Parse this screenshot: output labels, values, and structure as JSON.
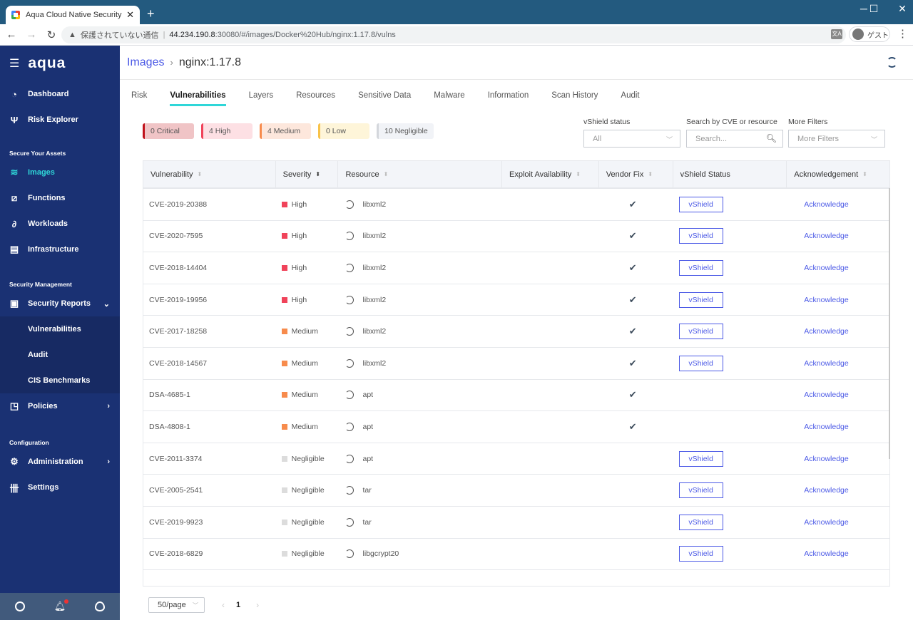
{
  "browser": {
    "tab_title": "Aqua Cloud Native Security Platfo",
    "new_tab": "+",
    "insecure_label": "保護されていない通信",
    "url_host": "44.234.190.8",
    "url_path": ":30080/#/images/Docker%20Hub/nginx:1.17.8/vulns",
    "profile_label": "ゲスト",
    "window_controls": {
      "minimize": "─",
      "maximize": "☐",
      "close": "✕"
    }
  },
  "sidebar": {
    "logo": "aqua",
    "top_items": [
      {
        "label": "Dashboard",
        "icon": "gauge-icon"
      },
      {
        "label": "Risk Explorer",
        "icon": "risk-explorer-icon"
      }
    ],
    "section_assets": "Secure Your Assets",
    "asset_items": [
      {
        "label": "Images",
        "icon": "layers-icon",
        "active": true
      },
      {
        "label": "Functions",
        "icon": "functions-icon"
      },
      {
        "label": "Workloads",
        "icon": "workloads-icon"
      },
      {
        "label": "Infrastructure",
        "icon": "server-icon"
      }
    ],
    "section_management": "Security Management",
    "security_reports": {
      "label": "Security Reports",
      "expanded": true
    },
    "report_subitems": [
      "Vulnerabilities",
      "Audit",
      "CIS Benchmarks"
    ],
    "policies": "Policies",
    "section_config": "Configuration",
    "administration": "Administration",
    "settings": "Settings"
  },
  "header": {
    "breadcrumb_parent": "Images",
    "breadcrumb_separator": "›",
    "breadcrumb_current": "nginx:1.17.8"
  },
  "tabs": [
    {
      "label": "Risk"
    },
    {
      "label": "Vulnerabilities",
      "active": true
    },
    {
      "label": "Layers"
    },
    {
      "label": "Resources"
    },
    {
      "label": "Sensitive Data"
    },
    {
      "label": "Malware"
    },
    {
      "label": "Information"
    },
    {
      "label": "Scan History"
    },
    {
      "label": "Audit"
    }
  ],
  "severity_summary": [
    {
      "label": "0 Critical",
      "bg": "#f0c4c6",
      "bar": "#c0111a"
    },
    {
      "label": "4 High",
      "bg": "#fde0e4",
      "bar": "#f0435a"
    },
    {
      "label": "4 Medium",
      "bg": "#fde7dc",
      "bar": "#f78b4c"
    },
    {
      "label": "0 Low",
      "bg": "#fef5d9",
      "bar": "#f8c249"
    },
    {
      "label": "10 Negligible",
      "bg": "#f1f3f7",
      "bar": "#d4d7dc"
    }
  ],
  "filters": {
    "vshield_label": "vShield status",
    "vshield_value": "All",
    "search_label": "Search by CVE or resource",
    "search_placeholder": "Search...",
    "more_label": "More Filters",
    "more_placeholder": "More Filters"
  },
  "table": {
    "columns": [
      "Vulnerability",
      "Severity",
      "Resource",
      "Exploit Availability",
      "Vendor Fix",
      "vShield Status",
      "Acknowledgement"
    ],
    "vshield_btn": "vShield",
    "ack_link": "Acknowledge",
    "check": "✔",
    "severity_colors": {
      "High": "#f0435a",
      "Medium": "#f78b4c",
      "Negligible": "#dcdcdc"
    },
    "rows": [
      {
        "vuln": "CVE-2019-20388",
        "severity": "High",
        "resource": "libxml2",
        "vendor_fix": true,
        "vshield": true
      },
      {
        "vuln": "CVE-2020-7595",
        "severity": "High",
        "resource": "libxml2",
        "vendor_fix": true,
        "vshield": true
      },
      {
        "vuln": "CVE-2018-14404",
        "severity": "High",
        "resource": "libxml2",
        "vendor_fix": true,
        "vshield": true
      },
      {
        "vuln": "CVE-2019-19956",
        "severity": "High",
        "resource": "libxml2",
        "vendor_fix": true,
        "vshield": true
      },
      {
        "vuln": "CVE-2017-18258",
        "severity": "Medium",
        "resource": "libxml2",
        "vendor_fix": true,
        "vshield": true
      },
      {
        "vuln": "CVE-2018-14567",
        "severity": "Medium",
        "resource": "libxml2",
        "vendor_fix": true,
        "vshield": true
      },
      {
        "vuln": "DSA-4685-1",
        "severity": "Medium",
        "resource": "apt",
        "vendor_fix": true,
        "vshield": false
      },
      {
        "vuln": "DSA-4808-1",
        "severity": "Medium",
        "resource": "apt",
        "vendor_fix": true,
        "vshield": false
      },
      {
        "vuln": "CVE-2011-3374",
        "severity": "Negligible",
        "resource": "apt",
        "vendor_fix": false,
        "vshield": true
      },
      {
        "vuln": "CVE-2005-2541",
        "severity": "Negligible",
        "resource": "tar",
        "vendor_fix": false,
        "vshield": true
      },
      {
        "vuln": "CVE-2019-9923",
        "severity": "Negligible",
        "resource": "tar",
        "vendor_fix": false,
        "vshield": true
      },
      {
        "vuln": "CVE-2018-6829",
        "severity": "Negligible",
        "resource": "libgcrypt20",
        "vendor_fix": false,
        "vshield": true
      }
    ]
  },
  "pagination": {
    "page_size": "50/page",
    "current_page": "1"
  }
}
